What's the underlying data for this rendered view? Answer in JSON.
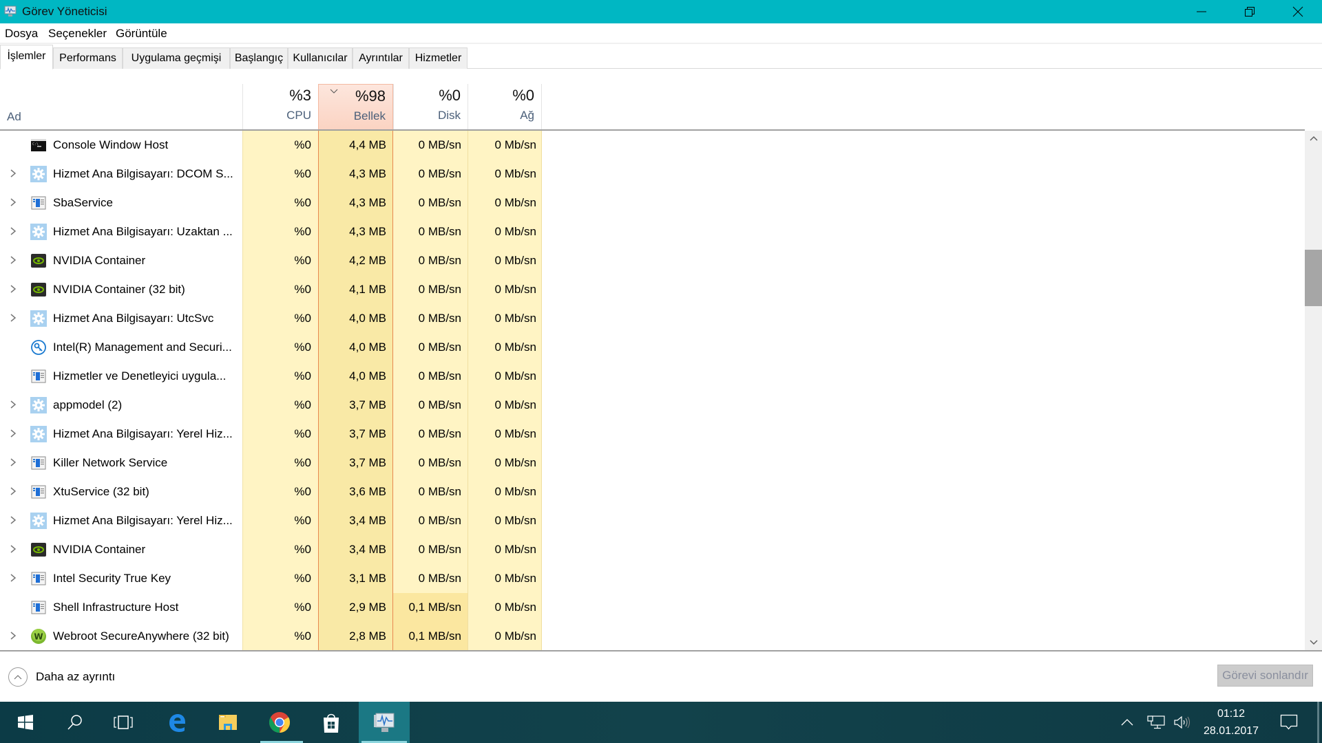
{
  "window": {
    "title": "Görev Yöneticisi",
    "controls": [
      "minimize",
      "restore",
      "close"
    ]
  },
  "menu": [
    "Dosya",
    "Seçenekler",
    "Görüntüle"
  ],
  "tabs": [
    {
      "label": "İşlemler",
      "active": true
    },
    {
      "label": "Performans",
      "active": false
    },
    {
      "label": "Uygulama geçmişi",
      "active": false
    },
    {
      "label": "Başlangıç",
      "active": false
    },
    {
      "label": "Kullanıcılar",
      "active": false
    },
    {
      "label": "Ayrıntılar",
      "active": false
    },
    {
      "label": "Hizmetler",
      "active": false
    }
  ],
  "columns": {
    "name": "Ad",
    "cpu": {
      "label": "CPU",
      "total": "%3"
    },
    "memory": {
      "label": "Bellek",
      "total": "%98",
      "sorted": true
    },
    "disk": {
      "label": "Disk",
      "total": "%0"
    },
    "network": {
      "label": "Ağ",
      "total": "%0"
    }
  },
  "processes": [
    {
      "name": "Console Window Host",
      "icon": "console-icon",
      "expandable": false,
      "cpu": "%0",
      "memory": "4,4 MB",
      "disk": "0 MB/sn",
      "network": "0 Mb/sn"
    },
    {
      "name": "Hizmet Ana Bilgisayarı: DCOM S...",
      "icon": "service-gear-icon",
      "expandable": true,
      "cpu": "%0",
      "memory": "4,3 MB",
      "disk": "0 MB/sn",
      "network": "0 Mb/sn"
    },
    {
      "name": "SbaService",
      "icon": "app-window-icon",
      "expandable": true,
      "cpu": "%0",
      "memory": "4,3 MB",
      "disk": "0 MB/sn",
      "network": "0 Mb/sn"
    },
    {
      "name": "Hizmet Ana Bilgisayarı: Uzaktan ...",
      "icon": "service-gear-icon",
      "expandable": true,
      "cpu": "%0",
      "memory": "4,3 MB",
      "disk": "0 MB/sn",
      "network": "0 Mb/sn"
    },
    {
      "name": "NVIDIA Container",
      "icon": "nvidia-icon",
      "expandable": true,
      "cpu": "%0",
      "memory": "4,2 MB",
      "disk": "0 MB/sn",
      "network": "0 Mb/sn"
    },
    {
      "name": "NVIDIA Container (32 bit)",
      "icon": "nvidia-icon",
      "expandable": true,
      "cpu": "%0",
      "memory": "4,1 MB",
      "disk": "0 MB/sn",
      "network": "0 Mb/sn"
    },
    {
      "name": "Hizmet Ana Bilgisayarı: UtcSvc",
      "icon": "service-gear-icon",
      "expandable": true,
      "cpu": "%0",
      "memory": "4,0 MB",
      "disk": "0 MB/sn",
      "network": "0 Mb/sn"
    },
    {
      "name": "Intel(R) Management and Securi...",
      "icon": "intel-key-icon",
      "expandable": false,
      "cpu": "%0",
      "memory": "4,0 MB",
      "disk": "0 MB/sn",
      "network": "0 Mb/sn"
    },
    {
      "name": "Hizmetler ve Denetleyici uygula...",
      "icon": "app-window-icon",
      "expandable": false,
      "cpu": "%0",
      "memory": "4,0 MB",
      "disk": "0 MB/sn",
      "network": "0 Mb/sn"
    },
    {
      "name": "appmodel (2)",
      "icon": "service-gear-icon",
      "expandable": true,
      "cpu": "%0",
      "memory": "3,7 MB",
      "disk": "0 MB/sn",
      "network": "0 Mb/sn"
    },
    {
      "name": "Hizmet Ana Bilgisayarı: Yerel Hiz...",
      "icon": "service-gear-icon",
      "expandable": true,
      "cpu": "%0",
      "memory": "3,7 MB",
      "disk": "0 MB/sn",
      "network": "0 Mb/sn"
    },
    {
      "name": "Killer Network Service",
      "icon": "app-window-icon",
      "expandable": true,
      "cpu": "%0",
      "memory": "3,7 MB",
      "disk": "0 MB/sn",
      "network": "0 Mb/sn"
    },
    {
      "name": "XtuService (32 bit)",
      "icon": "app-window-icon",
      "expandable": true,
      "cpu": "%0",
      "memory": "3,6 MB",
      "disk": "0 MB/sn",
      "network": "0 Mb/sn"
    },
    {
      "name": "Hizmet Ana Bilgisayarı: Yerel Hiz...",
      "icon": "service-gear-icon",
      "expandable": true,
      "cpu": "%0",
      "memory": "3,4 MB",
      "disk": "0 MB/sn",
      "network": "0 Mb/sn"
    },
    {
      "name": "NVIDIA Container",
      "icon": "nvidia-icon",
      "expandable": true,
      "cpu": "%0",
      "memory": "3,4 MB",
      "disk": "0 MB/sn",
      "network": "0 Mb/sn"
    },
    {
      "name": "Intel Security True Key",
      "icon": "app-window-icon",
      "expandable": true,
      "cpu": "%0",
      "memory": "3,1 MB",
      "disk": "0 MB/sn",
      "network": "0 Mb/sn"
    },
    {
      "name": "Shell Infrastructure Host",
      "icon": "app-window-icon",
      "expandable": false,
      "cpu": "%0",
      "memory": "2,9 MB",
      "disk": "0,1 MB/sn",
      "network": "0 Mb/sn"
    },
    {
      "name": "Webroot SecureAnywhere (32 bit)",
      "icon": "webroot-icon",
      "expandable": true,
      "cpu": "%0",
      "memory": "2,8 MB",
      "disk": "0,1 MB/sn",
      "network": "0 Mb/sn"
    }
  ],
  "scrollbar": {
    "position_fraction": 0.24
  },
  "footer": {
    "less_details": "Daha az ayrıntı",
    "end_task": "Görevi sonlandır",
    "end_task_enabled": false
  },
  "taskbar": {
    "items": [
      "start-icon",
      "search-icon",
      "task-view-icon",
      "edge-icon",
      "file-explorer-icon",
      "chrome-icon",
      "store-icon",
      "task-manager-icon"
    ],
    "active": "task-manager-icon",
    "clock": {
      "time": "01:12",
      "date": "28.01.2017"
    }
  },
  "colors": {
    "titlebar": "#00b7c3",
    "heat_low": "#fff4c4",
    "heat_memory": "#f9e9a6",
    "sorted_header": "#fbd3c2",
    "taskbar": "#0f3d47"
  }
}
